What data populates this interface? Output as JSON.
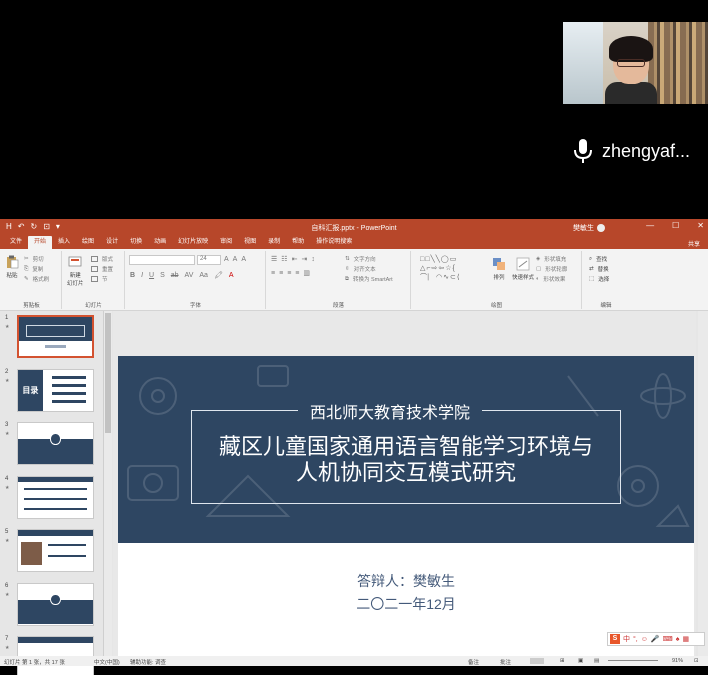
{
  "participant": {
    "name": "zhengyaf..."
  },
  "window": {
    "title": "自科汇报.pptx - PowerPoint",
    "user": "樊敏生",
    "quick_access": [
      "H",
      "↶",
      "↻",
      "⊡",
      "▾"
    ],
    "controls": [
      "—",
      "☐",
      "✕"
    ]
  },
  "menu": {
    "tabs": [
      "文件",
      "开始",
      "插入",
      "绘图",
      "设计",
      "切换",
      "动画",
      "幻灯片放映",
      "审阅",
      "视图",
      "录制",
      "帮助",
      "操作说明搜索"
    ],
    "active_index": 1,
    "share": "共享"
  },
  "ribbon": {
    "groups": [
      "剪贴板",
      "幻灯片",
      "字体",
      "段落",
      "绘图",
      "编辑"
    ],
    "paste": "粘贴",
    "cut": "剪切",
    "copy": "复制",
    "format_painter": "格式刷",
    "new_slide_line1": "新建",
    "new_slide_line2": "幻灯片",
    "layout": "版式",
    "reset": "重置",
    "section": "节",
    "font_size": "24",
    "text_direction": "文字方向",
    "align_text": "对齐文本",
    "smartart": "转换为 SmartArt",
    "arrange": "排列",
    "quick_styles": "快速样式",
    "shape_fill": "形状填充",
    "shape_outline": "形状轮廓",
    "shape_effects": "形状效果",
    "find": "查找",
    "replace": "替换",
    "select": "选择"
  },
  "thumbnails": [
    {
      "num": "1",
      "selected": true
    },
    {
      "num": "2",
      "label": "目录"
    },
    {
      "num": "3"
    },
    {
      "num": "4"
    },
    {
      "num": "5"
    },
    {
      "num": "6"
    },
    {
      "num": "7"
    }
  ],
  "slide": {
    "university": "西北师大教育技术学院",
    "title_line1": "藏区儿童国家通用语言智能学习环境与",
    "title_line2": "人机协同交互模式研究",
    "presenter": "答辩人：樊敏生",
    "date": "二〇二一年12月"
  },
  "status": {
    "slide_info": "幻灯片 第 1 张，共 17 张",
    "language": "中文(中国)",
    "accessibility": "辅助功能: 调查",
    "notes": "备注",
    "comments": "批注",
    "zoom": "91%"
  },
  "ime": {
    "logo": "S",
    "mode": "中"
  }
}
